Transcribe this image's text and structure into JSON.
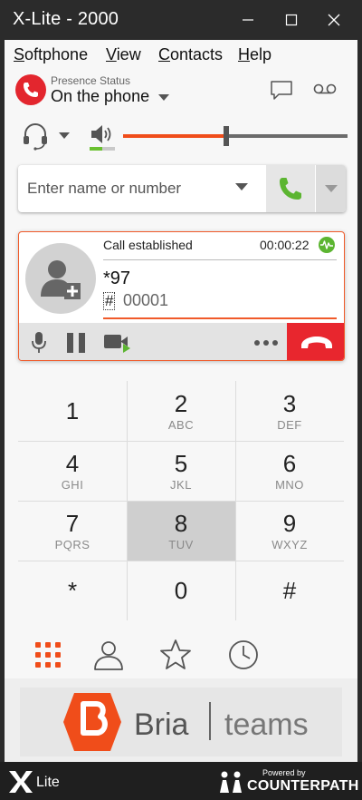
{
  "window": {
    "title": "X-Lite - 2000"
  },
  "menu": {
    "items": [
      {
        "accel": "S",
        "rest": "oftphone"
      },
      {
        "accel": "V",
        "rest": "iew"
      },
      {
        "accel": "C",
        "rest": "ontacts"
      },
      {
        "accel": "H",
        "rest": "elp"
      }
    ]
  },
  "presence": {
    "label": "Presence Status",
    "status": "On the phone"
  },
  "dialer": {
    "placeholder": "Enter name or number"
  },
  "call": {
    "state": "Call established",
    "duration": "00:00:22",
    "number": "*97",
    "hash_symbol": "#",
    "extension": "00001"
  },
  "keypad": {
    "keys": [
      {
        "digit": "1",
        "letters": ""
      },
      {
        "digit": "2",
        "letters": "ABC"
      },
      {
        "digit": "3",
        "letters": "DEF"
      },
      {
        "digit": "4",
        "letters": "GHI"
      },
      {
        "digit": "5",
        "letters": "JKL"
      },
      {
        "digit": "6",
        "letters": "MNO"
      },
      {
        "digit": "7",
        "letters": "PQRS"
      },
      {
        "digit": "8",
        "letters": "TUV"
      },
      {
        "digit": "9",
        "letters": "WXYZ"
      },
      {
        "digit": "*",
        "letters": ""
      },
      {
        "digit": "0",
        "letters": ""
      },
      {
        "digit": "#",
        "letters": ""
      }
    ],
    "pressed": "8"
  },
  "audio": {
    "speaker_volume": 0.46,
    "mic_level": 0.5
  },
  "tabs": [
    "dialpad-icon",
    "contacts-icon",
    "favorites-icon",
    "history-icon"
  ],
  "banner": {
    "brand": "Bria",
    "product": "teams"
  },
  "footer": {
    "app": "Lite",
    "powered": "Powered by",
    "company": "COUNTERPATH"
  },
  "colors": {
    "accent": "#f04d1a",
    "hangup": "#e8262e",
    "call": "#5cb531",
    "titlebar": "#2b2b2b"
  }
}
